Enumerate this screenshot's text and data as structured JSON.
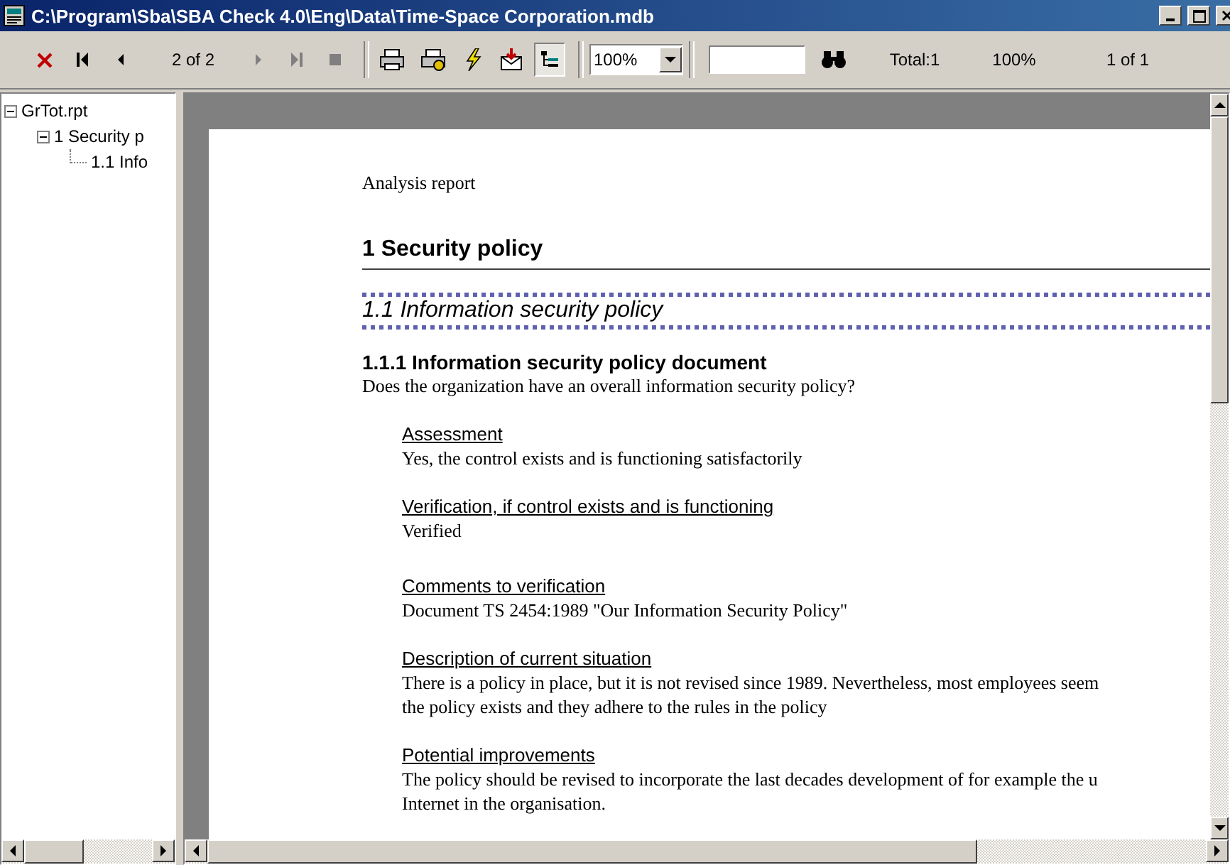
{
  "window": {
    "title": "C:\\Program\\Sba\\SBA Check 4.0\\Eng\\Data\\Time-Space Corporation.mdb"
  },
  "toolbar": {
    "page_indicator": "2 of 2",
    "tree_toggle_selected": true,
    "zoom": "100%",
    "total": "Total:1",
    "percent": "100%",
    "pages": "1 of 1"
  },
  "tree": [
    {
      "label": "GrTot.rpt",
      "expanded": true,
      "children": [
        {
          "label": "1 Security p",
          "expanded": true,
          "children": [
            {
              "label": "1.1 Info"
            }
          ]
        }
      ]
    }
  ],
  "report": {
    "header": "Analysis report",
    "section": "1 Security policy",
    "subsection": "1.1 Information security policy",
    "subsubsection": "1.1.1 Information security policy document",
    "question": "Does the organization have an overall information security policy?",
    "fields": [
      {
        "label": "Assessment",
        "lines": [
          "Yes, the control exists and is functioning satisfactorily"
        ]
      },
      {
        "label": "Verification, if control exists and is functioning",
        "lines": [
          "Verified"
        ]
      },
      {
        "label": "Comments to verification",
        "lines": [
          "Document TS 2454:1989 \"Our Information Security Policy\""
        ]
      },
      {
        "label": "Description of current situation",
        "lines": [
          "There is a policy in place, but it is not revised since 1989. Nevertheless, most employees seem",
          "the policy exists and they adhere to the rules in the policy"
        ]
      },
      {
        "label": "Potential improvements",
        "lines": [
          "The policy should be revised to incorporate the last decades development of for example the u",
          "Internet in the organisation."
        ]
      }
    ]
  }
}
